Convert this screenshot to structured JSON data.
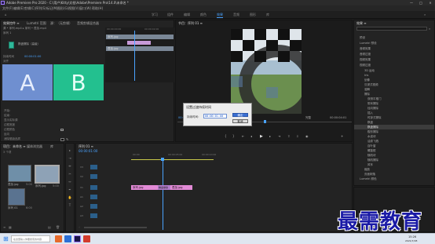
{
  "app": {
    "title": "Adobe Premiere Pro 2020 - C:\\用户\\Kitty\\文档\\Adobe\\Premiere Pro\\14.0\\未命名 *",
    "minimize": "—",
    "maximize": "□",
    "close": "×"
  },
  "menu": [
    "文件(F)",
    "编辑(E)",
    "剪辑(C)",
    "序列(S)",
    "标记(M)",
    "图形(G)",
    "视图(V)",
    "窗口(W)",
    "帮助(H)"
  ],
  "workspaces": {
    "items": [
      "学习",
      "组件",
      "编辑",
      "颜色",
      "效果",
      "音频",
      "图形",
      "库"
    ],
    "active_index": 4
  },
  "effect_controls": {
    "tabs": [
      "效果控件 ≡",
      "Lumetri 范围",
      "源：（无剪辑）",
      "音频剪辑混合器"
    ],
    "source_label": "源 • 序列.mp4 ▸ 序列 • 叠加.mp4",
    "sequence_label": "序列 1",
    "timecode_start": "00:00:00:00",
    "timecode_end": "00:00:02:00",
    "clip_a_label": "序列.jpg",
    "clip_b_label": "叠加.jpg",
    "transition_desc_1": "棋盘擦除（高级）",
    "transition_desc_2": "",
    "duration_label": "持续时间",
    "duration_value": "00:00:01:00",
    "alignment_label": "对齐",
    "a_text": "A",
    "b_text": "B",
    "rows": [
      "开始：",
      "结束：",
      "显示实际源",
      "边框宽度",
      "边框颜色",
      "反向",
      "消除锯齿品质"
    ],
    "bottom_timecode": "00:00:01:00"
  },
  "program_monitor": {
    "tab": "节目：序列 01 ≡",
    "timecode": "00:00:00:16",
    "fit": "适合",
    "quality": "完整",
    "end_timecode": "00:00:04:01"
  },
  "dialog": {
    "title": "设置过渡持续时间",
    "label": "持续时间：",
    "value": "00:00:01:00",
    "ok": "确定",
    "cancel": "取消"
  },
  "effects_panel": {
    "tab": "效果 ≡",
    "items": [
      "预设",
      "Lumetri 预设",
      "音频效果",
      "音频过渡",
      "视频效果",
      "视频过渡",
      "3D 运动",
      "Iris",
      "划像",
      "沉浸式视频",
      "溶解",
      "擦除",
      "双侧平推门",
      "带状擦除",
      "径向擦除",
      "插入",
      "时钟式擦除",
      "棋盘",
      "棋盘擦除",
      "楔形擦除",
      "水波块",
      "油漆飞溅",
      "百叶窗",
      "螺旋框",
      "随机块",
      "随机擦除",
      "风车",
      "缩放",
      "页面剥落",
      "Lumetri 颜色",
      "预设"
    ],
    "selected_index": 18
  },
  "project": {
    "tabs": [
      "项目：未命名 ≡",
      "媒体浏览器",
      "库"
    ],
    "count": "3 个项",
    "items": [
      "叠加.jpg",
      "序列.jpg",
      "序列 01"
    ],
    "item_durations": [
      "5:00",
      "5:00",
      "6:00"
    ]
  },
  "timeline": {
    "tab": "序列 01 ≡",
    "timecode": "00:00:01:00",
    "ruler_marks": [
      "00:00",
      "00:00:05:00",
      "00:00:10:00"
    ],
    "tracks": [
      "V3",
      "V2",
      "V1",
      "A1",
      "A2",
      "A3"
    ],
    "clip1": "序列.jpg",
    "clip2": "叠加.jpg",
    "transition": "棋盘擦除"
  },
  "taskbar": {
    "time": "15:26",
    "date": "2021/7/28",
    "search": "在这里输入你要搜索的内容"
  },
  "watermark": "最需教育"
}
